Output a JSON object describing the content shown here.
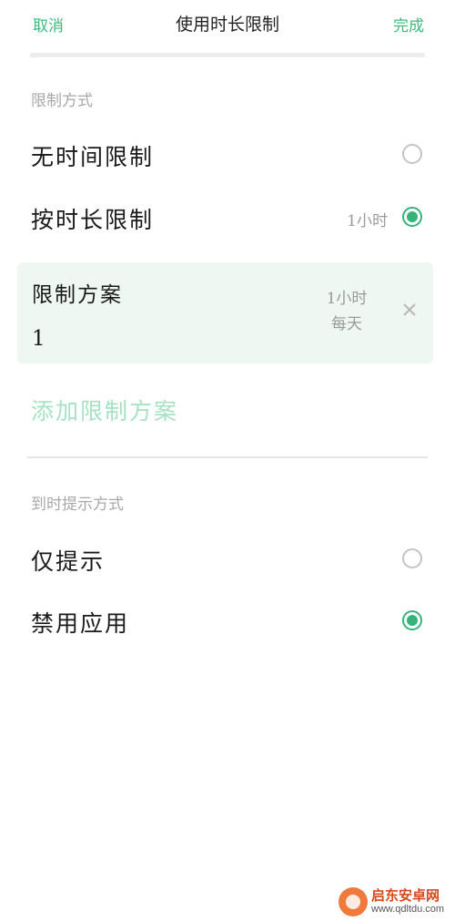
{
  "header": {
    "cancel_label": "取消",
    "title": "使用时长限制",
    "done_label": "完成"
  },
  "limit_section": {
    "label": "限制方式",
    "options": [
      {
        "label": "无时间限制",
        "value": "",
        "selected": false
      },
      {
        "label": "按时长限制",
        "value": "1小时",
        "selected": true
      }
    ]
  },
  "plan": {
    "name": "限制方案1",
    "duration": "1小时",
    "frequency": "每天"
  },
  "add_plan_label": "添加限制方案",
  "reminder_section": {
    "label": "到时提示方式",
    "options": [
      {
        "label": "仅提示",
        "selected": false
      },
      {
        "label": "禁用应用",
        "selected": true
      }
    ]
  },
  "watermark": {
    "brand": "启东安卓网",
    "url": "www.qdltdu.com"
  },
  "colors": {
    "accent": "#35b37a",
    "accent_light": "#a6e2c3",
    "card_bg": "#eef7f1"
  }
}
